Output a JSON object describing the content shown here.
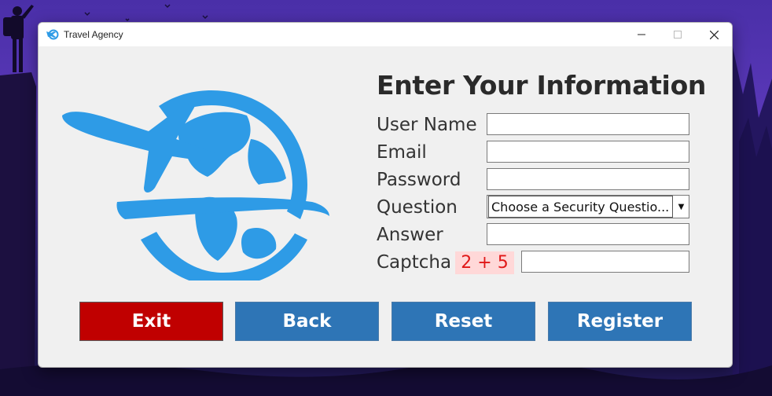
{
  "window": {
    "title": "Travel Agency",
    "controls": {
      "minimize": "—",
      "maximize": "☐",
      "close": "✕"
    }
  },
  "form": {
    "heading": "Enter Your Information",
    "fields": [
      {
        "label": "User Name",
        "value": ""
      },
      {
        "label": "Email",
        "value": ""
      },
      {
        "label": "Password",
        "value": ""
      },
      {
        "label": "Question",
        "value": "Choose a Security Questio..."
      },
      {
        "label": "Answer",
        "value": ""
      },
      {
        "label": "Captcha",
        "value": ""
      }
    ],
    "captcha_text": "2 + 5",
    "dropdown_arrow": "▼"
  },
  "buttons": {
    "exit": "Exit",
    "back": "Back",
    "reset": "Reset",
    "register": "Register"
  },
  "colors": {
    "logo_blue": "#2e9be6",
    "exit_red": "#c00000",
    "button_blue": "#2e75b6",
    "captcha_bg": "#ffd8d8",
    "captcha_text": "#e01818"
  }
}
